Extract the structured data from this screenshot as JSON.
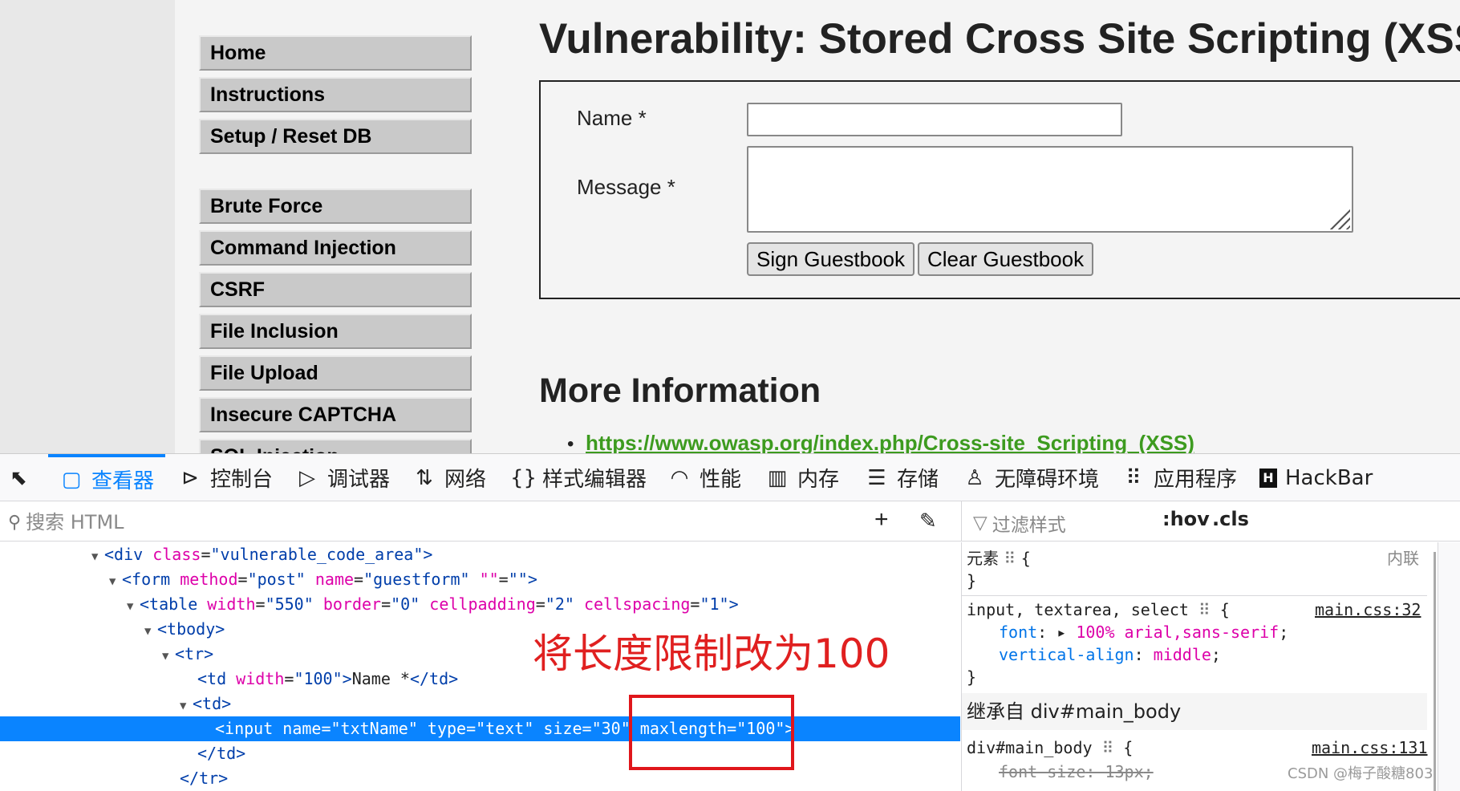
{
  "page": {
    "title": "Vulnerability: Stored Cross Site Scripting (XSS)",
    "menu_group1": [
      "Home",
      "Instructions",
      "Setup / Reset DB"
    ],
    "menu_group2": [
      "Brute Force",
      "Command Injection",
      "CSRF",
      "File Inclusion",
      "File Upload",
      "Insecure CAPTCHA",
      "SQL Injection"
    ],
    "form": {
      "name_label": "Name *",
      "message_label": "Message *",
      "name_value": "",
      "message_value": "",
      "sign_button": "Sign Guestbook",
      "clear_button": "Clear Guestbook"
    },
    "more_info_title": "More Information",
    "link": "https://www.owasp.org/index.php/Cross-site_Scripting_(XSS)",
    "link_color": "#3d9b1f"
  },
  "devtools": {
    "tabs": [
      {
        "icon": "picker-icon",
        "label": ""
      },
      {
        "icon": "inspector-icon",
        "label": "查看器"
      },
      {
        "icon": "console-icon",
        "label": "控制台"
      },
      {
        "icon": "debugger-icon",
        "label": "调试器"
      },
      {
        "icon": "network-icon",
        "label": "网络"
      },
      {
        "icon": "style-editor-icon",
        "label": "样式编辑器"
      },
      {
        "icon": "performance-icon",
        "label": "性能"
      },
      {
        "icon": "memory-icon",
        "label": "内存"
      },
      {
        "icon": "storage-icon",
        "label": "存储"
      },
      {
        "icon": "accessibility-icon",
        "label": "无障碍环境"
      },
      {
        "icon": "application-icon",
        "label": "应用程序"
      },
      {
        "icon": "hackbar-icon",
        "label": "HackBar"
      }
    ],
    "active_tab": "查看器",
    "accent_color": "#0a84ff",
    "search_placeholder": "搜索 HTML",
    "filter_placeholder": "过滤样式",
    "hov_label": ":hov",
    "cls_label": ".cls",
    "markup_lines": {
      "l1_tag": "<div",
      "l1_attr": "class",
      "l1_val": "\"vulnerable_code_area\"",
      "l2_tag": "<form",
      "l2_attr1": "method",
      "l2_val1": "\"post\"",
      "l2_attr2": "name",
      "l2_val2": "\"guestform\"",
      "l2_attr3": "\"\"",
      "l2_val3": "\"\"",
      "l3_tag": "<table",
      "l3_attr1": "width",
      "l3_val1": "\"550\"",
      "l3_attr2": "border",
      "l3_val2": "\"0\"",
      "l3_attr3": "cellpadding",
      "l3_val3": "\"2\"",
      "l3_attr4": "cellspacing",
      "l3_val4": "\"1\"",
      "l4": "<tbody>",
      "l5": "<tr>",
      "l6_tag": "<td",
      "l6_attr": "width",
      "l6_val": "\"100\"",
      "l6_text": "Name *",
      "l6_close": "</td>",
      "l7": "<td>",
      "l8": "<input name=\"txtName\" type=\"text\" size=\"30\" maxlength=\"100\">",
      "l9": "</td>",
      "l10": "</tr>"
    },
    "annotation": "将长度限制改为100",
    "annotation_color": "#e02020",
    "rules": {
      "element_label": "元素",
      "inline_label": "内联",
      "rule1_selector": "input, textarea, select",
      "rule1_source": "main.css:32",
      "rule1_prop1": "font",
      "rule1_val1": "100% arial,sans-serif",
      "rule1_prop2": "vertical-align",
      "rule1_val2": "middle",
      "inherited_header": "继承自 div#main_body",
      "rule2_selector": "div#main_body",
      "rule2_source": "main.css:131",
      "rule2_prop1": "font-size",
      "rule2_val1": "13px"
    }
  },
  "watermark": "CSDN @梅子酸糖803"
}
